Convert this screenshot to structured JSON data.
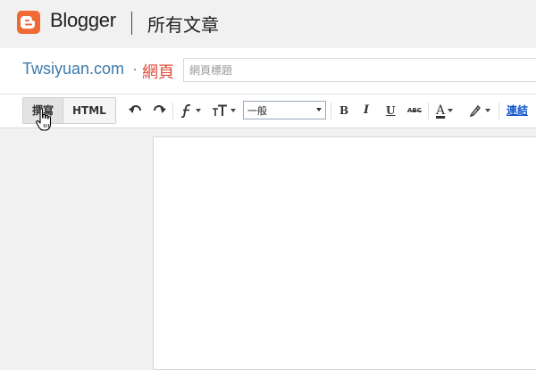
{
  "app": {
    "brand": "Blogger",
    "section_title": "所有文章"
  },
  "editor": {
    "blog_name": "Twsiyuan.com",
    "separator": "·",
    "content_kind": "網頁",
    "title_placeholder": "網頁標題"
  },
  "toolbar": {
    "compose_label": "撰寫",
    "html_label": "HTML",
    "undo_icon": "undo-icon",
    "redo_icon": "redo-icon",
    "font_icon": "font-family-icon",
    "font_size_icon": "font-size-icon",
    "format_value": "一般",
    "bold_label": "B",
    "italic_label": "I",
    "underline_label": "U",
    "strikethrough_label": "ABC",
    "text_color_label": "A",
    "link_label": "連結"
  },
  "colors": {
    "brand_orange": "#f06a35",
    "blog_name": "#3e7bac",
    "content_kind": "#dd4b39",
    "link": "#1155cc"
  }
}
